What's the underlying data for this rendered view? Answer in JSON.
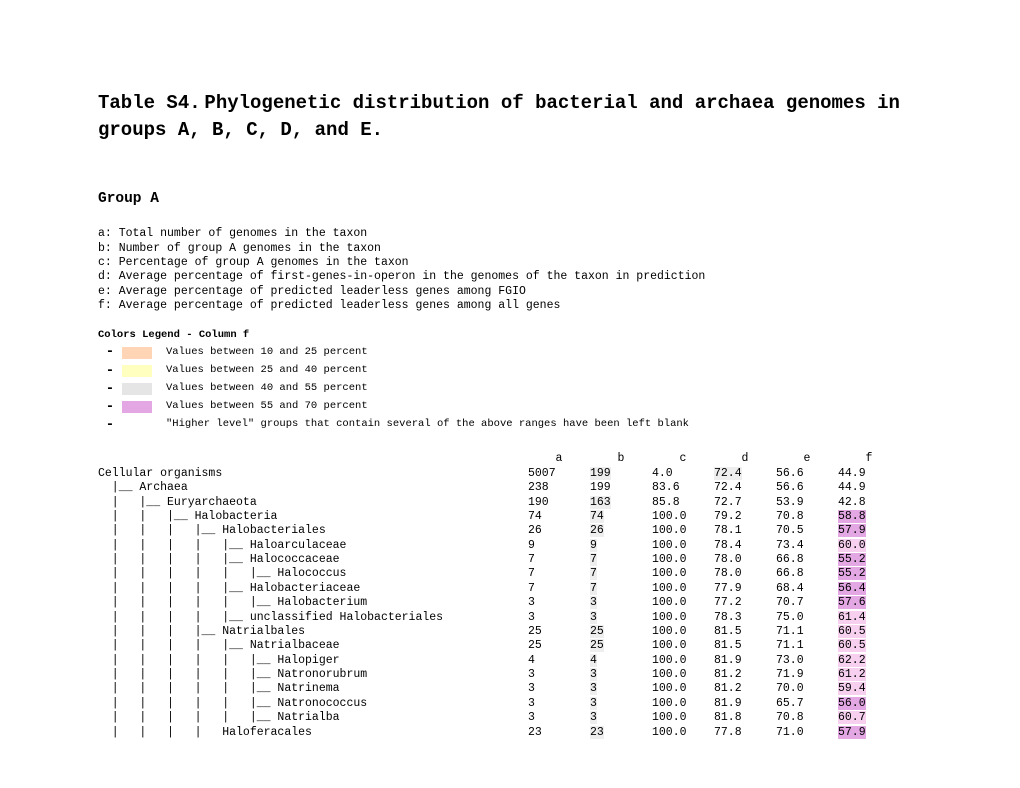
{
  "title": "Table S4. Phylogenetic distribution of bacterial and archaea genomes in groups A, B, C, D, and E.",
  "group_heading": "Group A",
  "definitions": [
    "a: Total number of genomes in the taxon",
    "b: Number of group A genomes in the taxon",
    "c: Percentage of group A genomes in the taxon",
    "d: Average percentage of first-genes-in-operon in the genomes of the taxon in prediction",
    "e: Average percentage of predicted leaderless genes among FGIO",
    "f: Average percentage of predicted leaderless genes among all genes"
  ],
  "legend": {
    "title": "Colors Legend - Column f",
    "items": [
      {
        "dash": "-",
        "color": "#ffd5b5",
        "text": "Values between 10 and 25  percent"
      },
      {
        "dash": "-",
        "color": "#ffffc0",
        "text": "Values between 25 and 40  percent"
      },
      {
        "dash": "-",
        "color": "#e5e5e5",
        "text": "Values between 40 and 55  percent"
      },
      {
        "dash": "-",
        "color": "#e3a7e3",
        "text": "Values between 55 and 70  percent"
      },
      {
        "dash": "-",
        "color": "",
        "text": "\"Higher level\" groups that contain several of the above ranges have been left blank"
      }
    ]
  },
  "columns": [
    "a",
    "b",
    "c",
    "d",
    "e",
    "f"
  ],
  "rows": [
    {
      "tree": "Cellular organisms",
      "a": "5007",
      "b": "199",
      "c": "4.0",
      "d": "72.4",
      "e": "56.6",
      "f": "44.9",
      "hl": {
        "b": true,
        "d": true
      }
    },
    {
      "tree": "  |__ Archaea",
      "a": "238",
      "b": "199",
      "c": "83.6",
      "d": "72.4",
      "e": "56.6",
      "f": "44.9",
      "hl": {}
    },
    {
      "tree": "  |   |__ Euryarchaeota",
      "a": "190",
      "b": "163",
      "c": "85.8",
      "d": "72.7",
      "e": "53.9",
      "f": "42.8",
      "hl": {
        "b": true
      }
    },
    {
      "tree": "  |   |   |__ Halobacteria",
      "a": "74",
      "b": "74",
      "c": "100.0",
      "d": "79.2",
      "e": "70.8",
      "f": "58.8",
      "hl": {
        "b": true,
        "f": "violet"
      }
    },
    {
      "tree": "  |   |   |   |__ Halobacteriales",
      "a": "26",
      "b": "26",
      "c": "100.0",
      "d": "78.1",
      "e": "70.5",
      "f": "57.9",
      "hl": {
        "b": true,
        "f": "violet"
      }
    },
    {
      "tree": "  |   |   |   |   |__ Haloarculaceae",
      "a": "9",
      "b": "9",
      "c": "100.0",
      "d": "78.4",
      "e": "73.4",
      "f": "60.0",
      "hl": {
        "b": true,
        "f": "pink"
      }
    },
    {
      "tree": "  |   |   |   |   |__ Halococcaceae",
      "a": "7",
      "b": "7",
      "c": "100.0",
      "d": "78.0",
      "e": "66.8",
      "f": "55.2",
      "hl": {
        "b": true,
        "f": "violet"
      }
    },
    {
      "tree": "  |   |   |   |   |   |__ Halococcus",
      "a": "7",
      "b": "7",
      "c": "100.0",
      "d": "78.0",
      "e": "66.8",
      "f": "55.2",
      "hl": {
        "b": true,
        "f": "violet"
      }
    },
    {
      "tree": "  |   |   |   |   |__ Halobacteriaceae",
      "a": "7",
      "b": "7",
      "c": "100.0",
      "d": "77.9",
      "e": "68.4",
      "f": "56.4",
      "hl": {
        "b": true,
        "f": "violet"
      }
    },
    {
      "tree": "  |   |   |   |   |   |__ Halobacterium",
      "a": "3",
      "b": "3",
      "c": "100.0",
      "d": "77.2",
      "e": "70.7",
      "f": "57.6",
      "hl": {
        "b": true,
        "f": "violet"
      }
    },
    {
      "tree": "  |   |   |   |   |__ unclassified Halobacteriales",
      "a": "3",
      "b": "3",
      "c": "100.0",
      "d": "78.3",
      "e": "75.0",
      "f": "61.4",
      "hl": {
        "b": true,
        "f": "pink"
      }
    },
    {
      "tree": "  |   |   |   |__ Natrialbales",
      "a": "25",
      "b": "25",
      "c": "100.0",
      "d": "81.5",
      "e": "71.1",
      "f": "60.5",
      "hl": {
        "b": true,
        "f": "pink"
      }
    },
    {
      "tree": "  |   |   |   |   |__ Natrialbaceae",
      "a": "25",
      "b": "25",
      "c": "100.0",
      "d": "81.5",
      "e": "71.1",
      "f": "60.5",
      "hl": {
        "b": true,
        "f": "pink"
      }
    },
    {
      "tree": "  |   |   |   |   |   |__ Halopiger",
      "a": "4",
      "b": "4",
      "c": "100.0",
      "d": "81.9",
      "e": "73.0",
      "f": "62.2",
      "hl": {
        "b": true,
        "f": "pink"
      }
    },
    {
      "tree": "  |   |   |   |   |   |__ Natronorubrum",
      "a": "3",
      "b": "3",
      "c": "100.0",
      "d": "81.2",
      "e": "71.9",
      "f": "61.2",
      "hl": {
        "b": true,
        "f": "pink"
      }
    },
    {
      "tree": "  |   |   |   |   |   |__ Natrinema",
      "a": "3",
      "b": "3",
      "c": "100.0",
      "d": "81.2",
      "e": "70.0",
      "f": "59.4",
      "hl": {
        "b": true,
        "f": "pink"
      }
    },
    {
      "tree": "  |   |   |   |   |   |__ Natronococcus",
      "a": "3",
      "b": "3",
      "c": "100.0",
      "d": "81.9",
      "e": "65.7",
      "f": "56.0",
      "hl": {
        "b": true,
        "f": "violet"
      }
    },
    {
      "tree": "  |   |   |   |   |   |__ Natrialba",
      "a": "3",
      "b": "3",
      "c": "100.0",
      "d": "81.8",
      "e": "70.8",
      "f": "60.7",
      "hl": {
        "b": true,
        "f": "pink"
      }
    },
    {
      "tree": "  |   |   |   |   Haloferacales",
      "a": "23",
      "b": "23",
      "c": "100.0",
      "d": "77.8",
      "e": "71.0",
      "f": "57.9",
      "hl": {
        "b": true,
        "f": "violet"
      }
    }
  ]
}
